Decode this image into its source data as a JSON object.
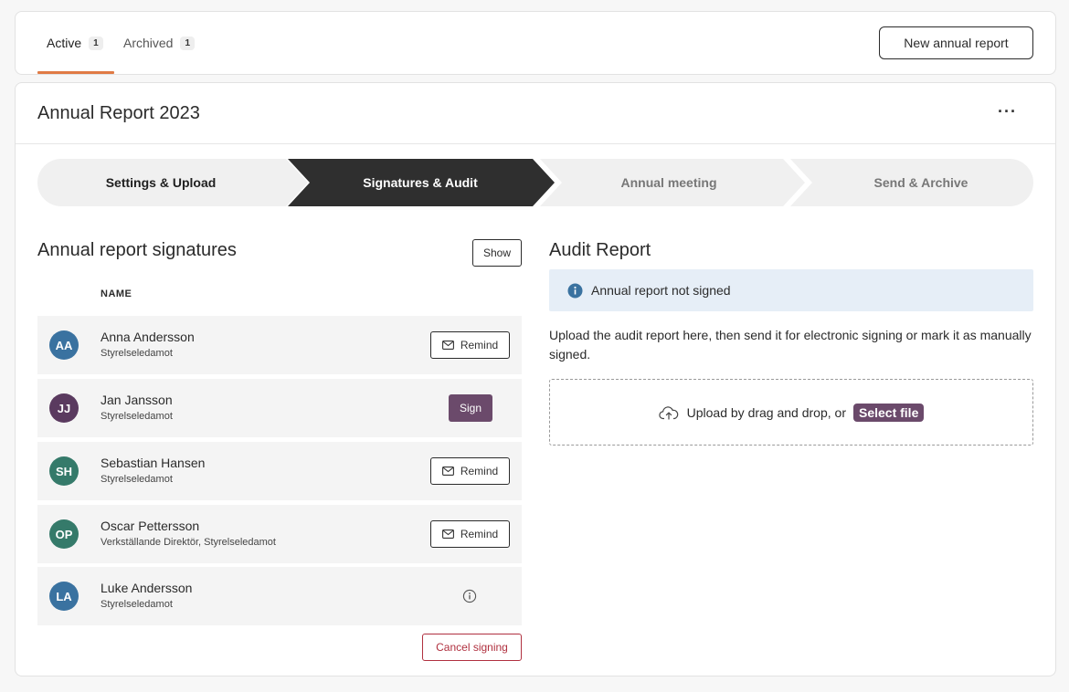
{
  "tabs": [
    {
      "label": "Active",
      "count": "1"
    },
    {
      "label": "Archived",
      "count": "1"
    }
  ],
  "header": {
    "new_report_label": "New annual report"
  },
  "report": {
    "title": "Annual Report 2023",
    "more_label": "···"
  },
  "steps": [
    {
      "label": "Settings & Upload",
      "state": "done"
    },
    {
      "label": "Signatures & Audit",
      "state": "current"
    },
    {
      "label": "Annual meeting",
      "state": "upcoming"
    },
    {
      "label": "Send & Archive",
      "state": "upcoming"
    }
  ],
  "signatures": {
    "title": "Annual report signatures",
    "show_label": "Show",
    "column_name": "NAME",
    "rows": [
      {
        "initials": "AA",
        "name": "Anna Andersson",
        "role": "Styrelseledamot",
        "action": "Remind",
        "avatar_color": "#3a72a0"
      },
      {
        "initials": "JJ",
        "name": "Jan Jansson",
        "role": "Styrelseledamot",
        "action": "Sign",
        "avatar_color": "#5a3a5f"
      },
      {
        "initials": "SH",
        "name": "Sebastian Hansen",
        "role": "Styrelseledamot",
        "action": "Remind",
        "avatar_color": "#357a6a"
      },
      {
        "initials": "OP",
        "name": "Oscar Pettersson",
        "role": "Verkställande Direktör, Styrelseledamot",
        "action": "Remind",
        "avatar_color": "#357a6a"
      },
      {
        "initials": "LA",
        "name": "Luke Andersson",
        "role": "Styrelseledamot",
        "action": "info",
        "avatar_color": "#3a72a0"
      }
    ],
    "cancel_label": "Cancel signing"
  },
  "audit": {
    "title": "Audit Report",
    "alert_text": "Annual report not signed",
    "description": "Upload the audit report here, then send it for electronic signing or mark it as manually signed.",
    "drop_text": "Upload by drag and drop, or",
    "select_label": "Select file"
  },
  "colors": {
    "accent_tab": "#e07a45",
    "step_current": "#2f2f2f",
    "step_idle": "#f0f0f0",
    "primary_button": "#6b4a6b",
    "danger": "#b0303f",
    "alert_bg": "#e6eef7",
    "info_icon": "#3a72a0"
  }
}
